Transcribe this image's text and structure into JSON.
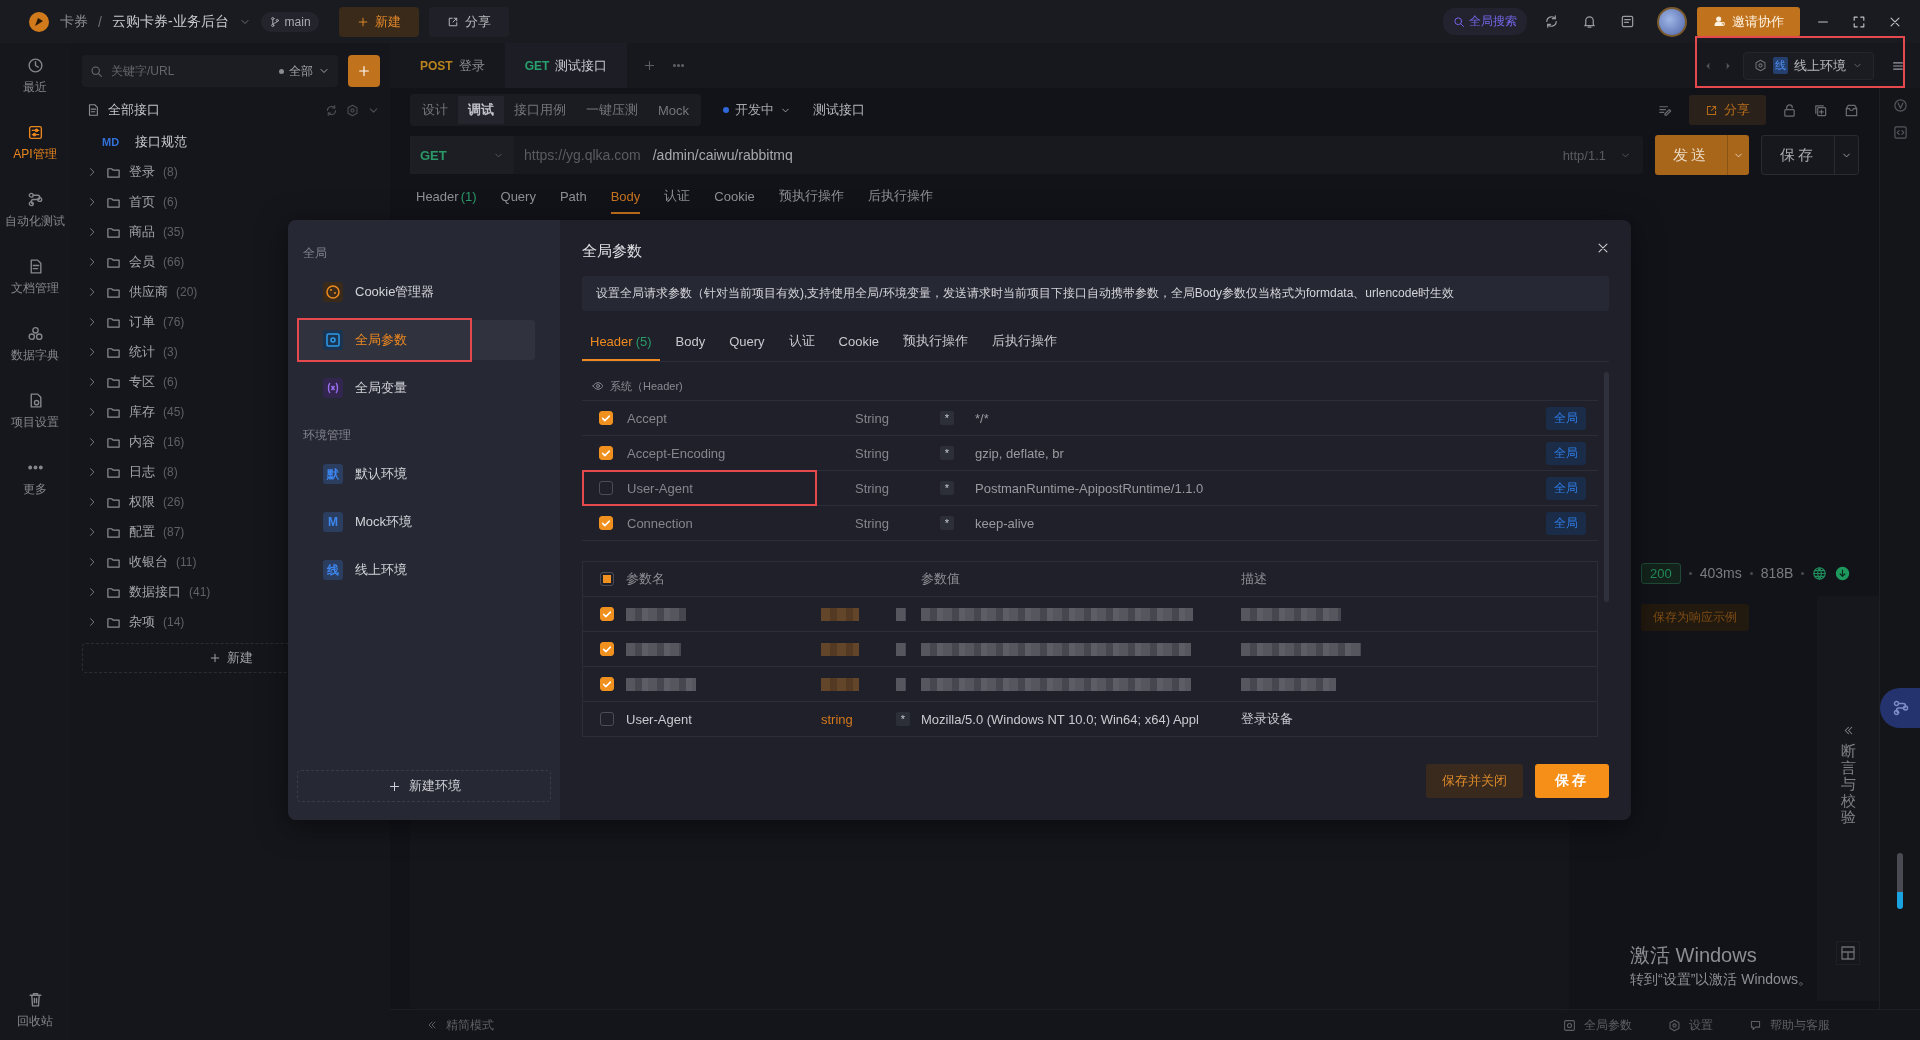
{
  "top_bar": {
    "brand": "卡券",
    "separator": "/",
    "project": "云购卡券-业务后台",
    "branch": "main",
    "new_button": "新建",
    "share_button": "分享",
    "global_search": "全局搜索",
    "invite_button": "邀请协作"
  },
  "nav_rail": {
    "items": [
      {
        "label": "最近",
        "selected": false
      },
      {
        "label": "API管理",
        "selected": true
      },
      {
        "label": "自动化测试",
        "selected": false
      },
      {
        "label": "文档管理",
        "selected": false
      },
      {
        "label": "数据字典",
        "selected": false
      },
      {
        "label": "项目设置",
        "selected": false
      },
      {
        "label": "更多",
        "selected": false
      }
    ],
    "trash": "回收站"
  },
  "tree": {
    "search": {
      "placeholder": "关键字/URL",
      "filter": "全部"
    },
    "root": "全部接口",
    "spec": {
      "badge": "MD",
      "label": "接口规范"
    },
    "folders": [
      {
        "name": "登录",
        "count": "(8)"
      },
      {
        "name": "首页",
        "count": "(6)"
      },
      {
        "name": "商品",
        "count": "(35)"
      },
      {
        "name": "会员",
        "count": "(66)"
      },
      {
        "name": "供应商",
        "count": "(20)"
      },
      {
        "name": "订单",
        "count": "(76)"
      },
      {
        "name": "统计",
        "count": "(3)"
      },
      {
        "name": "专区",
        "count": "(6)"
      },
      {
        "name": "库存",
        "count": "(45)"
      },
      {
        "name": "内容",
        "count": "(16)"
      },
      {
        "name": "日志",
        "count": "(8)"
      },
      {
        "name": "权限",
        "count": "(26)"
      },
      {
        "name": "配置",
        "count": "(87)"
      },
      {
        "name": "收银台",
        "count": "(11)"
      },
      {
        "name": "数据接口",
        "count": "(41)"
      },
      {
        "name": "杂项",
        "count": "(14)"
      }
    ],
    "new_button": "新建"
  },
  "request_tabs": [
    {
      "method": "POST",
      "name": "登录",
      "selected": false
    },
    {
      "method": "GET",
      "name": "测试接口",
      "selected": true
    }
  ],
  "environment": {
    "badge": "线",
    "name": "线上环境",
    "highlighted": true
  },
  "mode_tabs": [
    {
      "label": "设计",
      "selected": false
    },
    {
      "label": "调试",
      "selected": true
    },
    {
      "label": "接口用例",
      "selected": false
    },
    {
      "label": "一键压测",
      "selected": false
    },
    {
      "label": "Mock",
      "selected": false
    }
  ],
  "api_status": "开发中",
  "api_name": "测试接口",
  "share_button": "分享",
  "url_bar": {
    "method": "GET",
    "host": "https://yg.qlka.com",
    "path": "/admin/caiwu/rabbitmq",
    "protocol": "http/1.1",
    "send_button": "发送",
    "save_button": "保存"
  },
  "section_tabs": [
    {
      "label": "Header",
      "count": "(1)",
      "selected": false
    },
    {
      "label": "Query",
      "selected": false
    },
    {
      "label": "Path",
      "selected": false
    },
    {
      "label": "Body",
      "selected": true
    },
    {
      "label": "认证",
      "selected": false
    },
    {
      "label": "Cookie",
      "selected": false
    },
    {
      "label": "预执行操作",
      "selected": false
    },
    {
      "label": "后执行操作",
      "selected": false
    }
  ],
  "response": {
    "status_code": "200",
    "time": "403ms",
    "size": "818B",
    "save_example": "保存为响应示例",
    "side_panel": "断言与校验"
  },
  "status_bar": {
    "compact_mode": "精简模式",
    "items": [
      {
        "label": "全局参数"
      },
      {
        "label": "设置"
      },
      {
        "label": "帮助与客服"
      }
    ]
  },
  "windows_notice": {
    "title": "激活 Windows",
    "subtitle": "转到“设置”以激活 Windows。"
  },
  "modal": {
    "sidebar": {
      "sections": [
        {
          "heading": "全局",
          "items": [
            {
              "label": "Cookie管理器",
              "selected": false,
              "highlighted": false
            },
            {
              "label": "全局参数",
              "selected": true,
              "highlighted": true
            },
            {
              "label": "全局变量",
              "selected": false,
              "highlighted": false
            }
          ]
        },
        {
          "heading": "环境管理",
          "items": [
            {
              "label": "默认环境",
              "badge": "默",
              "selected": false,
              "highlighted": false
            },
            {
              "label": "Mock环境",
              "badge": "M",
              "selected": false,
              "highlighted": false
            },
            {
              "label": "线上环境",
              "badge": "线",
              "selected": false,
              "highlighted": false
            }
          ]
        }
      ],
      "new_button": "新建环境"
    },
    "title": "全局参数",
    "notice": "设置全局请求参数（针对当前项目有效),支持使用全局/环境变量，发送请求时当前项目下接口自动携带参数，全局Body参数仅当格式为formdata、urlencode时生效",
    "tabs": [
      {
        "label": "Header",
        "count": "(5)",
        "selected": true
      },
      {
        "label": "Body",
        "selected": false
      },
      {
        "label": "Query",
        "selected": false
      },
      {
        "label": "认证",
        "selected": false
      },
      {
        "label": "Cookie",
        "selected": false
      },
      {
        "label": "预执行操作",
        "selected": false
      },
      {
        "label": "后执行操作",
        "selected": false
      }
    ],
    "system_section": {
      "label": "系统（Header)",
      "rows": [
        {
          "checked": true,
          "name": "Accept",
          "type": "String",
          "required_mark": "*",
          "value": "*/*",
          "scope": "全局",
          "highlighted": false
        },
        {
          "checked": true,
          "name": "Accept-Encoding",
          "type": "String",
          "required_mark": "*",
          "value": "gzip, deflate, br",
          "scope": "全局",
          "highlighted": false
        },
        {
          "checked": false,
          "name": "User-Agent",
          "type": "String",
          "required_mark": "*",
          "value": "PostmanRuntime-ApipostRuntime/1.1.0",
          "scope": "全局",
          "highlighted": true
        },
        {
          "checked": true,
          "name": "Connection",
          "type": "String",
          "required_mark": "*",
          "value": "keep-alive",
          "scope": "全局",
          "highlighted": false
        }
      ]
    },
    "params": {
      "select_all_indeterminate": true,
      "columns": [
        "参数名",
        "参数值",
        "描述"
      ],
      "rows": [
        {
          "kind": "redacted",
          "checked": true
        },
        {
          "kind": "redacted",
          "checked": true
        },
        {
          "kind": "redacted",
          "checked": true
        },
        {
          "kind": "plain",
          "checked": false,
          "name": "User-Agent",
          "type": "string",
          "required_mark": "*",
          "value": "Mozilla/5.0 (Windows NT 10.0; Win64; x64) Appl",
          "description": "登录设备"
        }
      ]
    },
    "buttons": {
      "save_close": "保存并关闭",
      "save": "保存"
    }
  }
}
